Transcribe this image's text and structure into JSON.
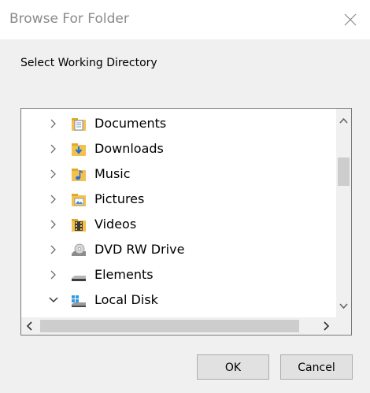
{
  "dialog": {
    "title": "Browse For Folder",
    "prompt": "Select Working Directory"
  },
  "tree": {
    "items": [
      {
        "label": "Documents",
        "icon": "documents-folder-icon",
        "expanded": false
      },
      {
        "label": "Downloads",
        "icon": "downloads-folder-icon",
        "expanded": false
      },
      {
        "label": "Music",
        "icon": "music-folder-icon",
        "expanded": false
      },
      {
        "label": "Pictures",
        "icon": "pictures-folder-icon",
        "expanded": false
      },
      {
        "label": "Videos",
        "icon": "videos-folder-icon",
        "expanded": false
      },
      {
        "label": "DVD RW Drive",
        "icon": "dvd-drive-icon",
        "expanded": false
      },
      {
        "label": "Elements",
        "icon": "drive-icon",
        "expanded": false
      },
      {
        "label": "Local Disk",
        "icon": "local-disk-icon",
        "expanded": true
      }
    ]
  },
  "buttons": {
    "ok_label": "OK",
    "cancel_label": "Cancel"
  },
  "colors": {
    "folder": "#f2c14e",
    "download_arrow": "#1e73d8",
    "music_note": "#2a6fd6"
  }
}
